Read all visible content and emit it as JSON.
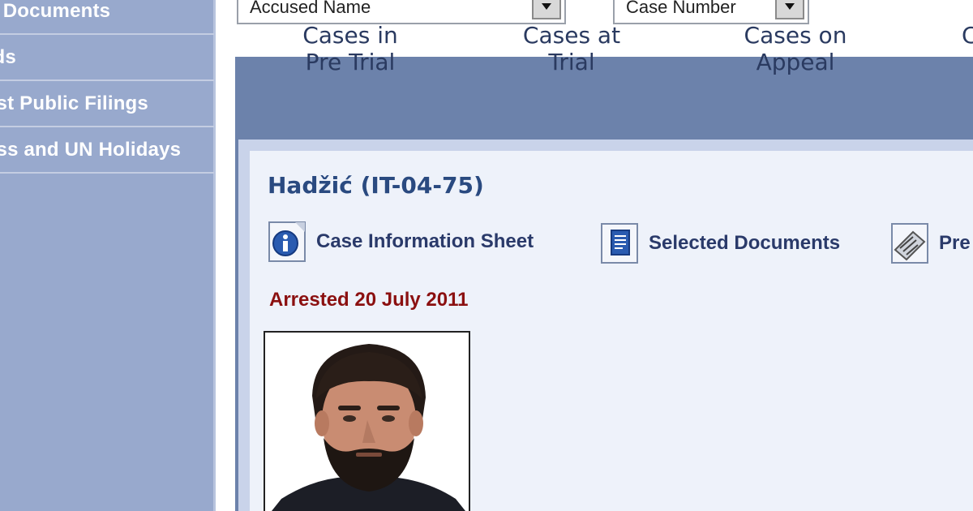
{
  "sidebar": {
    "items": [
      {
        "label": "d Documents"
      },
      {
        "label": "rds"
      },
      {
        "label": "est Public Filings"
      },
      {
        "label": "ess and UN Holidays"
      }
    ]
  },
  "search": {
    "accused_select": "Accused Name",
    "case_select": "Case Number"
  },
  "tabs": [
    {
      "line1": "Cases in",
      "line2": "Pre Trial"
    },
    {
      "line1": "Cases at",
      "line2": "Trial"
    },
    {
      "line1": "Cases on",
      "line2": "Appeal"
    },
    {
      "line1": "C",
      "line2": ""
    }
  ],
  "case": {
    "title": "Hadžić (IT-04-75)",
    "links": [
      {
        "label": "Case Information Sheet",
        "icon": "info-icon"
      },
      {
        "label": "Selected Documents",
        "icon": "document-icon"
      },
      {
        "label": "Pre",
        "icon": "press-icon"
      }
    ],
    "status": "Arrested 20 July 2011",
    "photo_label": "accused-photo"
  },
  "colors": {
    "sidebar_bg": "#98a9cd",
    "tab_band": "#6c82ab",
    "panel_bg": "#eef2fa",
    "title_color": "#2a4a80",
    "status_color": "#8b1010"
  }
}
